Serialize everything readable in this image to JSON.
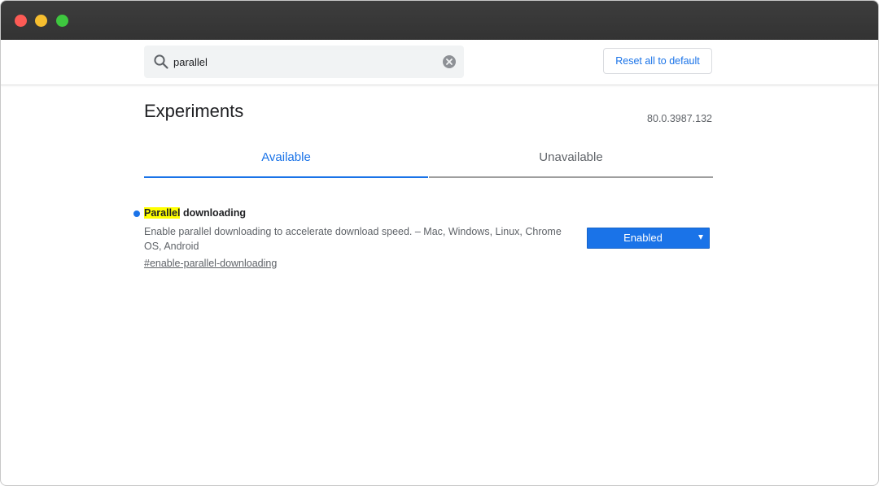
{
  "window": {
    "traffic_lights": [
      "close",
      "minimize",
      "maximize"
    ]
  },
  "search": {
    "value": "parallel",
    "placeholder": "Search flags",
    "icon": "search-icon",
    "clear_icon": "clear-icon"
  },
  "toolbar": {
    "reset_label": "Reset all to default"
  },
  "page": {
    "title": "Experiments",
    "version": "80.0.3987.132"
  },
  "tabs": [
    {
      "label": "Available",
      "active": true
    },
    {
      "label": "Unavailable",
      "active": false
    }
  ],
  "experiments": [
    {
      "title_highlight": "Parallel",
      "title_rest": " downloading",
      "description": "Enable parallel downloading to accelerate download speed. – Mac, Windows, Linux, Chrome OS, Android",
      "link": "#enable-parallel-downloading",
      "state": "Enabled"
    }
  ],
  "colors": {
    "accent": "#1a73e8",
    "highlight": "#ffff00",
    "titlebar": "#3a3a3a"
  }
}
